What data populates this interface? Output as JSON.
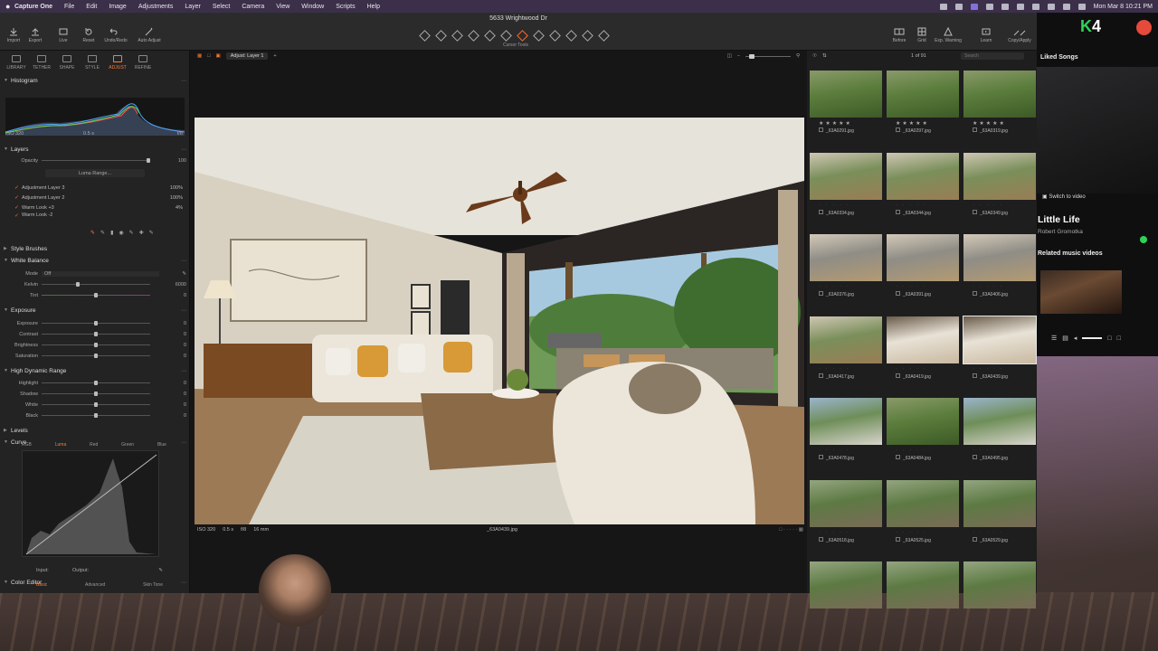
{
  "menubar": {
    "app_name": "Capture One",
    "menus": [
      "File",
      "Edit",
      "Image",
      "Adjustments",
      "Layer",
      "Select",
      "Camera",
      "View",
      "Window",
      "Scripts",
      "Help"
    ],
    "clock": "Mon Mar 8  10:21 PM"
  },
  "window": {
    "title": "5633 Wrightwood Dr"
  },
  "toolbar": {
    "left": [
      "Import",
      "Export",
      "Live",
      "Reset",
      "Undo/Redo",
      "Auto Adjust"
    ],
    "cursor_tools_label": "Cursor Tools",
    "right": [
      "Before",
      "Grid",
      "Exp. Warning",
      "Learn",
      "Copy/Apply"
    ]
  },
  "tool_tabs": [
    "LIBRARY",
    "TETHER",
    "SHAPE",
    "STYLE",
    "ADJUST",
    "REFINE"
  ],
  "left": {
    "histogram": {
      "title": "Histogram",
      "iso": "ISO 320",
      "shutter": "0.5 s",
      "aperture": "f/8"
    },
    "layers": {
      "title": "Layers",
      "opacity_label": "Opacity",
      "opacity_value": "100",
      "luma_range": "Luma Range...",
      "items": [
        {
          "name": "Adjustment Layer 3",
          "pct": "100%"
        },
        {
          "name": "Adjustment Layer 2",
          "pct": "100%"
        },
        {
          "name": "Warm Look +3",
          "pct": "4%"
        },
        {
          "name": "Warm Look -2",
          "pct": ""
        }
      ]
    },
    "style_brushes": "Style Brushes",
    "white_balance": {
      "title": "White Balance",
      "mode_label": "Mode",
      "mode_value": "Off",
      "kelvin_label": "Kelvin",
      "kelvin_value": "6000",
      "tint_label": "Tint",
      "tint_value": "0"
    },
    "exposure": {
      "title": "Exposure",
      "rows": [
        {
          "label": "Exposure",
          "value": "0"
        },
        {
          "label": "Contrast",
          "value": "0"
        },
        {
          "label": "Brightness",
          "value": "0"
        },
        {
          "label": "Saturation",
          "value": "0"
        }
      ]
    },
    "hdr": {
      "title": "High Dynamic Range",
      "rows": [
        {
          "label": "Highlight",
          "value": "0"
        },
        {
          "label": "Shadow",
          "value": "0"
        },
        {
          "label": "White",
          "value": "0"
        },
        {
          "label": "Black",
          "value": "0"
        }
      ]
    },
    "levels": "Levels",
    "curve": {
      "title": "Curve",
      "tabs": [
        "RGB",
        "Luma",
        "Red",
        "Green",
        "Blue"
      ],
      "input_label": "Input:",
      "output_label": "Output:"
    },
    "color_editor": {
      "title": "Color Editor",
      "tabs": [
        "Basic",
        "Advanced",
        "Skin Tone"
      ]
    }
  },
  "viewer": {
    "layer_dropdown": "Adjust: Layer 1",
    "meta": {
      "iso": "ISO 320",
      "shutter": "0.5 s",
      "aperture": "f/8",
      "focal": "16 mm"
    },
    "filename": "_63A0439.jpg"
  },
  "browser": {
    "count": "1 of 91",
    "search_placeholder": "Search",
    "thumbs": [
      {
        "name": "_63A0291.jpg",
        "stars": "★★★★★",
        "scene": "garden"
      },
      {
        "name": "_63A0297.jpg",
        "stars": "★★★★★",
        "scene": "garden"
      },
      {
        "name": "_63A0319.jpg",
        "stars": "★★★★★",
        "scene": "garden"
      },
      {
        "name": "_63A0334.jpg",
        "stars": "· · · · ·",
        "scene": "yard"
      },
      {
        "name": "_63A0344.jpg",
        "stars": "· · · · ·",
        "scene": "yard"
      },
      {
        "name": "_63A0349.jpg",
        "stars": "· · · · ·",
        "scene": "yard"
      },
      {
        "name": "_63A0376.jpg",
        "stars": "· · · · ·",
        "scene": "patio"
      },
      {
        "name": "_63A0391.jpg",
        "stars": "· · · · ·",
        "scene": "patio"
      },
      {
        "name": "_63A0406.jpg",
        "stars": "· · · · ·",
        "scene": "patio"
      },
      {
        "name": "_63A0417.jpg",
        "stars": "· · · · ·",
        "scene": "yard"
      },
      {
        "name": "_63A0419.jpg",
        "stars": "· · · · ·",
        "scene": "interior"
      },
      {
        "name": "_63A0439.jpg",
        "stars": "· · · · ·",
        "scene": "interior"
      },
      {
        "name": "_63A0478.jpg",
        "stars": "· · · · ·",
        "scene": "house"
      },
      {
        "name": "_63A0484.jpg",
        "stars": "· · · · ·",
        "scene": "garden"
      },
      {
        "name": "_63A0495.jpg",
        "stars": "· · · · ·",
        "scene": "house"
      },
      {
        "name": "_63A0518.jpg",
        "stars": "· · · · ·",
        "scene": "aerial"
      },
      {
        "name": "_63A0525.jpg",
        "stars": "· · · · ·",
        "scene": "aerial"
      },
      {
        "name": "_63A0529.jpg",
        "stars": "· · · · ·",
        "scene": "aerial"
      },
      {
        "name": "",
        "stars": "",
        "scene": "aerial"
      },
      {
        "name": "",
        "stars": "",
        "scene": "aerial"
      },
      {
        "name": "",
        "stars": "",
        "scene": "aerial"
      }
    ]
  },
  "side": {
    "logo_k": "K",
    "logo_num": "4",
    "playlist_title": "Liked Songs",
    "switch_to_video": "Switch to video",
    "song": "Little Life",
    "artist": "Robert Gromotka",
    "related": "Related music videos"
  },
  "colors": {
    "accent": "#ff7a32",
    "panel": "#232324",
    "viewer": "#161617"
  }
}
